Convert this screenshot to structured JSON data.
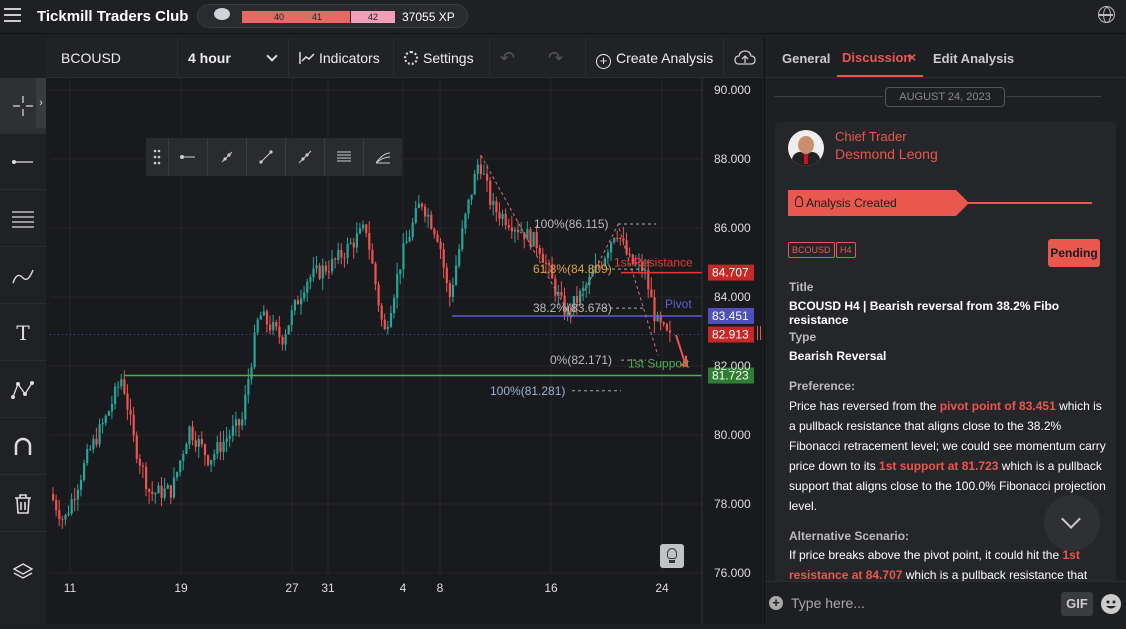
{
  "app": {
    "title": "Tickmill Traders Club",
    "levels": [
      "40",
      "41",
      "42"
    ],
    "xp": "37055 XP"
  },
  "chart_toolbar": {
    "symbol": "BCOUSD",
    "timeframe": "4 hour",
    "indicators": "Indicators",
    "settings": "Settings",
    "create_analysis": "Create Analysis"
  },
  "chart": {
    "price_axis": [
      "90.000",
      "88.000",
      "86.000",
      "84.000",
      "82.000",
      "80.000",
      "78.000",
      "76.000"
    ],
    "x_axis": [
      "11",
      "19",
      "27",
      "31",
      "4",
      "8",
      "16",
      "24"
    ],
    "price_badges": {
      "resistance": "84.707",
      "pivot": "83.451",
      "current": "82.913",
      "support": "81.723"
    },
    "labels": {
      "fib100_top": "100%(86.115)",
      "fib618": "61.8%(84.809)",
      "fib382": "38.2%(83.678)",
      "fib0": "0%(82.171)",
      "fib100_bottom": "100%(81.281)",
      "resistance": "1st Resistance",
      "pivot": "Pivot",
      "support": "1st Support"
    },
    "colors": {
      "resistance": "#e53935",
      "pivot": "#5c5fd6",
      "support": "#4caf50",
      "up": "#26a69a",
      "down": "#ef5350"
    }
  },
  "panel": {
    "tabs": [
      "General",
      "Discussion",
      "Edit Analysis"
    ],
    "date": "AUGUST 24, 2023",
    "role": "Chief Trader",
    "name": "Desmond Leong",
    "status_banner": "Analysis Created",
    "tags": [
      "BCOUSD",
      "H4"
    ],
    "status": "Pending",
    "title_label": "Title",
    "title_value": "BCOUSD H4 | Bearish reversal from 38.2% Fibo resistance",
    "type_label": "Type",
    "type_value": "Bearish Reversal",
    "preference_label": "Preference:",
    "pref_1": "Price has reversed from the ",
    "pref_hl1": "pivot point of 83.451",
    "pref_2": " which is a pullback resistance that aligns close to the 38.2% Fibonacci retracement level; we could see momentum carry price down to its ",
    "pref_hl2": "1st support at 81.723",
    "pref_3": " which is a pullback support that aligns close to the 100.0% Fibonacci projection level.",
    "alt_label": "Alternative Scenario:",
    "alt_1": "If price breaks above the pivot point, it could hit the ",
    "alt_hl": "1st resistance at 84.707",
    "alt_2": " which is a pullback resistance that",
    "composer_placeholder": "Type here...",
    "gif": "GIF"
  }
}
